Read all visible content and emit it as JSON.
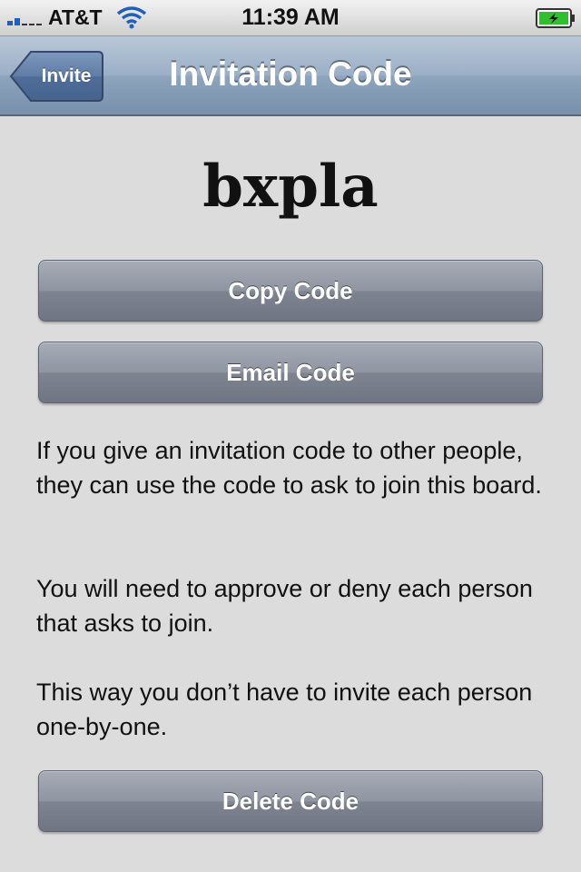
{
  "status_bar": {
    "carrier": "AT&T",
    "time": "11:39 AM",
    "icons": [
      "signal-strength-icon",
      "wifi-icon",
      "battery-charging-icon"
    ]
  },
  "nav": {
    "back_label": "Invite",
    "title": "Invitation Code"
  },
  "code": {
    "value": "bxpla"
  },
  "buttons": {
    "copy": "Copy Code",
    "email": "Email Code",
    "delete": "Delete Code"
  },
  "description": {
    "p1": "If you give an invitation code to other people, they can use the code to ask to join this board.",
    "p2": "You will need to approve or deny each person that asks to join.",
    "p3": "This way you don’t have to invite each person one-by-one."
  },
  "colors": {
    "nav_bar": "#8ea4bd",
    "button": "#868c98",
    "background": "#dcdcdc",
    "battery_fill": "#2fbf2f"
  }
}
